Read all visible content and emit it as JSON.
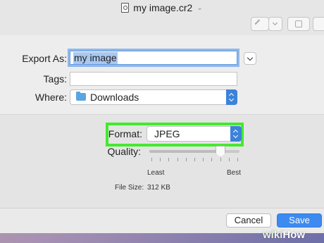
{
  "window": {
    "title": "my image.cr2",
    "toolbar": [
      "markup-pen-icon",
      "markup-dropdown-icon",
      "rotate-icon"
    ]
  },
  "export_dialog": {
    "export_as": {
      "label": "Export As:",
      "value": "my image"
    },
    "tags": {
      "label": "Tags:",
      "value": ""
    },
    "where": {
      "label": "Where:",
      "value": "Downloads",
      "icon": "folder-icon"
    },
    "format": {
      "label": "Format:",
      "value": "JPEG"
    },
    "quality": {
      "label": "Quality:",
      "min_label": "Least",
      "max_label": "Best",
      "level": 0.79
    },
    "file_size": {
      "label": "File Size:",
      "value": "312 KB"
    },
    "buttons": {
      "cancel": "Cancel",
      "save": "Save"
    }
  },
  "colors": {
    "accent": "#3b83d9",
    "save_button": "#3d8bf0",
    "highlight": "#44ea2d"
  },
  "watermark": {
    "wiki": "wiki",
    "how": "How"
  }
}
